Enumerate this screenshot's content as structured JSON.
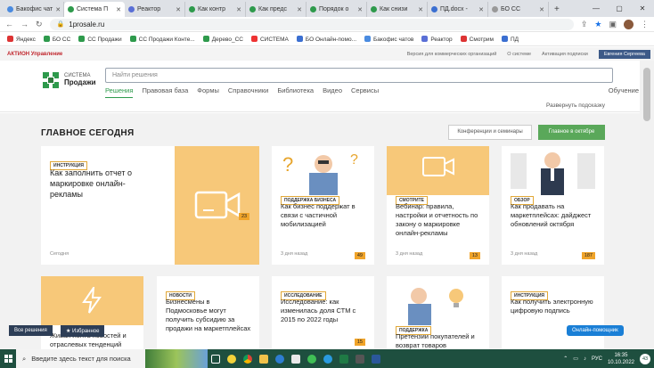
{
  "browser": {
    "tabs": [
      {
        "label": "Бакофис чат",
        "color": "#4a8be0",
        "active": false
      },
      {
        "label": "Система П",
        "color": "#2e9a4c",
        "active": true
      },
      {
        "label": "Реактор",
        "color": "#5a6fd6",
        "active": false
      },
      {
        "label": "Как контр",
        "color": "#2e9a4c",
        "active": false
      },
      {
        "label": "Как предс",
        "color": "#2e9a4c",
        "active": false
      },
      {
        "label": "Порядок о",
        "color": "#2e9a4c",
        "active": false
      },
      {
        "label": "Как снизи",
        "color": "#2e9a4c",
        "active": false
      },
      {
        "label": "ПД.docx -",
        "color": "#3b6fd1",
        "active": false
      },
      {
        "label": "БО СС",
        "color": "#999999",
        "active": false
      }
    ],
    "url": "1prosale.ru",
    "bookmarks": [
      "Яндекс",
      "БО СС",
      "СС Продажи",
      "СС Продажи Конте...",
      "Дерево_СС",
      "СИСТЕМА",
      "БО Онлайн-помо...",
      "Бакофис чатов",
      "Реактор",
      "Смотрим",
      "ПД"
    ]
  },
  "site": {
    "brand": "АКТИОН Управление",
    "top_links": [
      "Версия для коммерческих организаций",
      "О системе",
      "Активация подписки"
    ],
    "user": "Евгения Сергеева",
    "logo_top": "СИСТЕМА",
    "logo_bottom": "Продажи",
    "search_placeholder": "Найти решения",
    "menu": [
      "Решения",
      "Правовая база",
      "Формы",
      "Справочники",
      "Библиотека",
      "Видео",
      "Сервисы"
    ],
    "learning": "Обучение",
    "hint": "Развернуть подсказку",
    "section_title": "ГЛАВНОЕ СЕГОДНЯ",
    "btn_seminars": "Конференции и семинары",
    "btn_october": "Главное в октябре"
  },
  "cards_row1": [
    {
      "tag": "ИНСТРУКЦИЯ",
      "title": "Как заполнить отчет о маркировке онлайн-рекламы",
      "date": "Сегодня",
      "count": "23"
    },
    {
      "tag": "ПОДДЕРЖКА БИЗНЕСА",
      "title": "Как бизнес поддержат в связи с частичной мобилизацией",
      "date": "3 дня назад",
      "count": "49"
    },
    {
      "tag": "СМОТРИТЕ",
      "title": "Вебинар: правила, настройки и отчетность по закону о маркировке онлайн-рекламы",
      "date": "3 дня назад",
      "count": "13"
    },
    {
      "tag": "ОБЗОР",
      "title": "Как продавать на маркетплейсах: дайджест обновлений октября",
      "date": "3 дня назад",
      "count": "187"
    }
  ],
  "cards_row2": [
    {
      "tag": "",
      "title": "Живая лента новостей и отраслевых тенденций",
      "count": ""
    },
    {
      "tag": "НОВОСТИ",
      "title": "Бизнесмены в Подмосковье могут получить субсидию за продажи на маркетплейсах",
      "count": ""
    },
    {
      "tag": "ИССЛЕДОВАНИЕ",
      "title": "Исследование: как изменилась доля СТМ с 2015 по 2022 годы",
      "count": "15"
    },
    {
      "tag": "ПОДДЕРЖКА",
      "title": "Претензии покупателей и возврат товаров",
      "count": ""
    },
    {
      "tag": "ИНСТРУКЦИЯ",
      "title": "Как получить электронную цифровую подпись",
      "count": ""
    }
  ],
  "floating": {
    "all": "Все решения",
    "fav": "★ Избранное",
    "online": "Онлайн-помощник"
  },
  "taskbar": {
    "search": "Введите здесь текст для поиска",
    "lang": "РУС",
    "time": "16:35",
    "date": "10.10.2022",
    "notif": "43"
  }
}
